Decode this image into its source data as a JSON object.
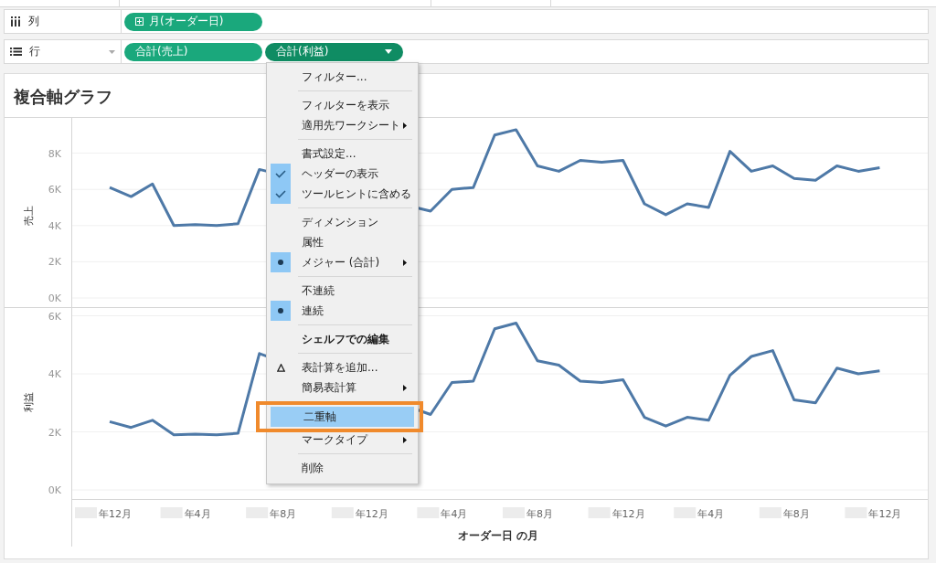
{
  "shelves": [
    {
      "kind": "columns",
      "label": "列",
      "pills": [
        {
          "label": "月(オーダー日)",
          "kind": "date",
          "selected": false
        }
      ]
    },
    {
      "kind": "rows",
      "label": "行",
      "pills": [
        {
          "label": "合計(売上)",
          "kind": "measure",
          "selected": false
        },
        {
          "label": "合計(利益)",
          "kind": "measure",
          "selected": true
        }
      ]
    }
  ],
  "sheet": {
    "title": "複合軸グラフ",
    "charts": [
      {
        "chart_data": {
          "type": "line",
          "ylabel": "売上",
          "grid": true,
          "series": [
            {
              "color": "#4e79a7",
              "values": [
                6.1,
                5.6,
                6.3,
                4.0,
                4.05,
                4.0,
                4.1,
                7.1,
                null,
                null,
                null,
                null,
                null,
                null,
                null,
                4.8,
                6.0,
                6.1,
                9.0,
                9.3,
                7.3,
                7.0,
                7.6,
                7.5,
                7.6,
                5.2,
                4.6,
                5.2,
                5.0,
                8.1,
                7.0,
                7.3,
                6.6,
                6.5,
                7.3,
                7.0,
                7.2
              ]
            }
          ],
          "ylim": [
            0,
            10
          ],
          "yticks": [
            {
              "value": 0,
              "label": "0K"
            },
            {
              "value": 2,
              "label": "2K"
            },
            {
              "value": 4,
              "label": "4K"
            },
            {
              "value": 6,
              "label": "6K"
            },
            {
              "value": 8,
              "label": "8K"
            }
          ]
        }
      },
      {
        "chart_data": {
          "type": "line",
          "ylabel": "利益",
          "xlabel": "オーダー日 の月",
          "grid": true,
          "categories": [
            "年12月",
            null,
            null,
            null,
            "年4月",
            null,
            null,
            null,
            "年8月",
            null,
            null,
            null,
            "年12月",
            null,
            null,
            null,
            "年4月",
            null,
            null,
            null,
            "年8月",
            null,
            null,
            null,
            "年12月",
            null,
            null,
            null,
            "年4月",
            null,
            null,
            null,
            "年8月",
            null,
            null,
            null,
            "年12月"
          ],
          "series": [
            {
              "color": "#4e79a7",
              "values": [
                2.35,
                2.15,
                2.4,
                1.9,
                1.92,
                1.9,
                1.95,
                4.7,
                null,
                null,
                null,
                null,
                null,
                null,
                null,
                2.6,
                3.7,
                3.75,
                5.55,
                5.75,
                4.45,
                4.3,
                3.75,
                3.7,
                3.8,
                2.5,
                2.2,
                2.5,
                2.4,
                3.95,
                4.6,
                4.8,
                3.1,
                3.0,
                4.2,
                4.0,
                4.1
              ]
            }
          ],
          "ylim": [
            0,
            6.3
          ],
          "yticks": [
            {
              "value": 0,
              "label": "0K"
            },
            {
              "value": 2,
              "label": "2K"
            },
            {
              "value": 4,
              "label": "4K"
            },
            {
              "value": 6,
              "label": "6K"
            }
          ]
        }
      }
    ]
  },
  "context_menu": {
    "items": [
      {
        "kind": "item",
        "label": "フィルター...",
        "submenu": false,
        "highlighted": false
      },
      {
        "kind": "separator"
      },
      {
        "kind": "item",
        "label": "フィルターを表示",
        "submenu": false,
        "highlighted": false
      },
      {
        "kind": "item",
        "label": "適用先ワークシート",
        "submenu": true,
        "highlighted": false
      },
      {
        "kind": "separator"
      },
      {
        "kind": "item",
        "label": "書式設定...",
        "submenu": false,
        "highlighted": false
      },
      {
        "kind": "check",
        "label": "ヘッダーの表示",
        "checked": true,
        "submenu": false,
        "highlighted": false
      },
      {
        "kind": "check",
        "label": "ツールヒントに含める",
        "checked": true,
        "submenu": false,
        "highlighted": false
      },
      {
        "kind": "separator"
      },
      {
        "kind": "radio",
        "label": "ディメンション",
        "checked": false,
        "submenu": false,
        "highlighted": false
      },
      {
        "kind": "radio",
        "label": "属性",
        "checked": false,
        "submenu": false,
        "highlighted": false
      },
      {
        "kind": "radio",
        "label": "メジャー (合計)",
        "checked": true,
        "submenu": true,
        "highlighted": false
      },
      {
        "kind": "separator"
      },
      {
        "kind": "radio",
        "label": "不連続",
        "checked": false,
        "submenu": false,
        "highlighted": false
      },
      {
        "kind": "radio",
        "label": "連続",
        "checked": true,
        "submenu": false,
        "highlighted": false
      },
      {
        "kind": "separator"
      },
      {
        "kind": "item",
        "label": "シェルフでの編集",
        "bold": true,
        "submenu": false,
        "highlighted": false
      },
      {
        "kind": "separator"
      },
      {
        "kind": "calc",
        "label": "表計算を追加...",
        "submenu": false,
        "highlighted": false
      },
      {
        "kind": "item",
        "label": "簡易表計算",
        "submenu": true,
        "highlighted": false
      },
      {
        "kind": "separator"
      },
      {
        "kind": "item",
        "label": "二重軸",
        "submenu": false,
        "highlighted": true,
        "callout": true
      },
      {
        "kind": "item",
        "label": "マークタイプ",
        "submenu": true,
        "highlighted": false
      },
      {
        "kind": "separator"
      },
      {
        "kind": "item",
        "label": "削除",
        "submenu": false,
        "highlighted": false
      }
    ]
  }
}
